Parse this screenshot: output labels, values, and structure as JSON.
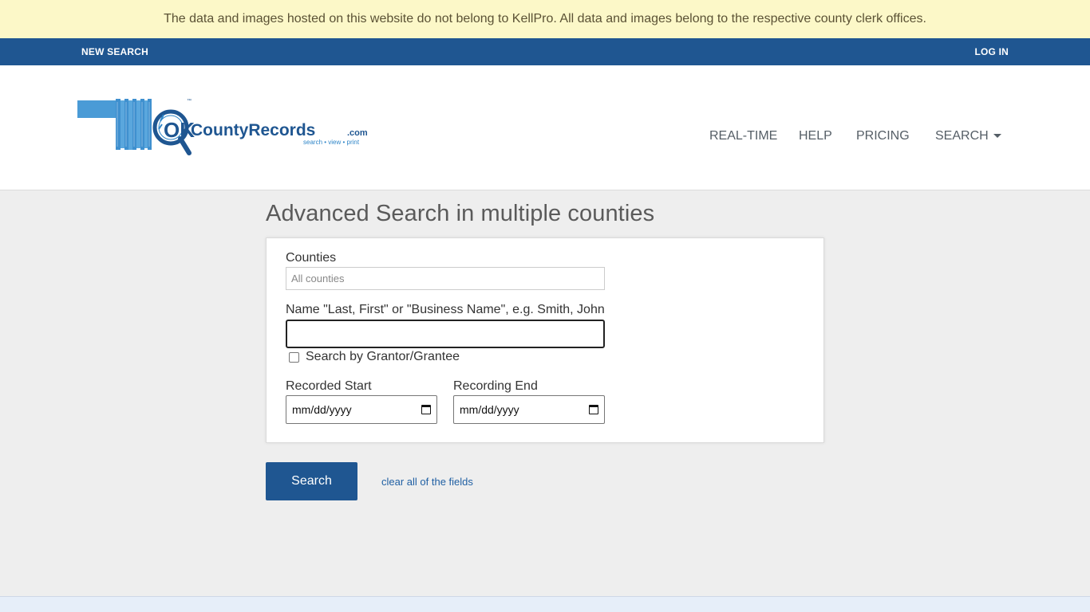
{
  "notice": {
    "text": "The data and images hosted on this website do not belong to KellPro. All data and images belong to the respective county clerk offices."
  },
  "topbar": {
    "new_search": "NEW SEARCH",
    "login": "LOG IN"
  },
  "logo": {
    "text_ok": "OK",
    "text_county_records": "CountyRecords",
    "text_com": ".com",
    "tagline": "search • view • print",
    "tm": "™"
  },
  "nav": {
    "realtime": "REAL-TIME",
    "help": "HELP",
    "pricing": "PRICING",
    "search": "SEARCH"
  },
  "page": {
    "title": "Advanced Search in multiple counties"
  },
  "form": {
    "counties_label": "Counties",
    "counties_placeholder": "All counties",
    "name_label": "Name \"Last, First\" or \"Business Name\", e.g. Smith, John",
    "name_value": "",
    "grantor_label": "Search by Grantor/Grantee",
    "grantor_checked": false,
    "recorded_start_label": "Recorded Start",
    "recording_end_label": "Recording End",
    "date_placeholder": "mm/dd/yyyy"
  },
  "actions": {
    "search": "Search",
    "clear": "clear all of the fields"
  },
  "colors": {
    "brand_blue": "#1f5691",
    "notice_bg": "#fcf8c8",
    "logo_blue": "#2f86c8"
  }
}
